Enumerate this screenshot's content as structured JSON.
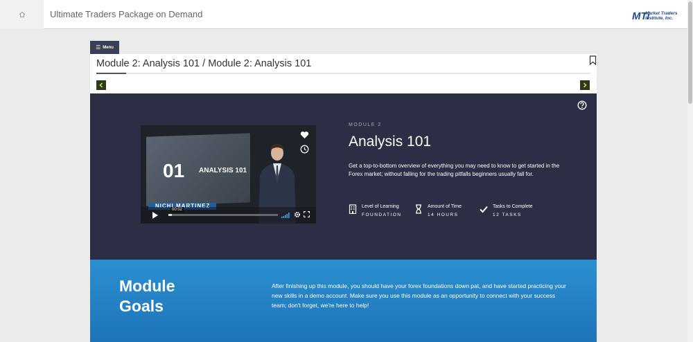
{
  "header": {
    "title": "Ultimate Traders Package on Demand",
    "logo_mark": "MTi",
    "logo_line1": "Market Traders",
    "logo_line2": "Institute, Inc."
  },
  "menu": {
    "label": "Menu"
  },
  "page": {
    "breadcrumb": "Module 2: Analysis 101 / Module 2: Analysis 101",
    "progress_percent": 6
  },
  "video": {
    "slide_number": "01",
    "slide_title": "ANALYSIS 101",
    "lower_third": "NICHI MARTINEZ",
    "current_time": "00:02",
    "played_fraction": 0.03
  },
  "module": {
    "label": "MODULE 2",
    "title": "Analysis 101",
    "description": "Get a top-to-bottom overview of everything you may need to know to get started in the Forex market; without falling for the trading pitfalls beginners usually fall for.",
    "stats": [
      {
        "label": "Level of Learning",
        "value": "FOUNDATION",
        "icon": "building-icon"
      },
      {
        "label": "Amount of Time",
        "value": "14 HOURS",
        "icon": "hourglass-icon"
      },
      {
        "label": "Tasks to Complete",
        "value": "12 TASKS",
        "icon": "checkmark-icon"
      }
    ]
  },
  "goals": {
    "title_line1": "Module",
    "title_line2": "Goals",
    "text": "After finishing up this module, you should have your forex foundations down pat, and have started practicing your new skills in a demo account. Make sure you use this module as an opportunity to connect with your success team; don't forget, we're here to help!"
  },
  "colors": {
    "hero_bg": "#2b2e45",
    "goals_bg": "#2a8fd0",
    "menu_bg": "#3a3f55",
    "nav_arrow_bg": "#2d3a1d",
    "nav_arrow_glyph": "#d8e64a"
  }
}
